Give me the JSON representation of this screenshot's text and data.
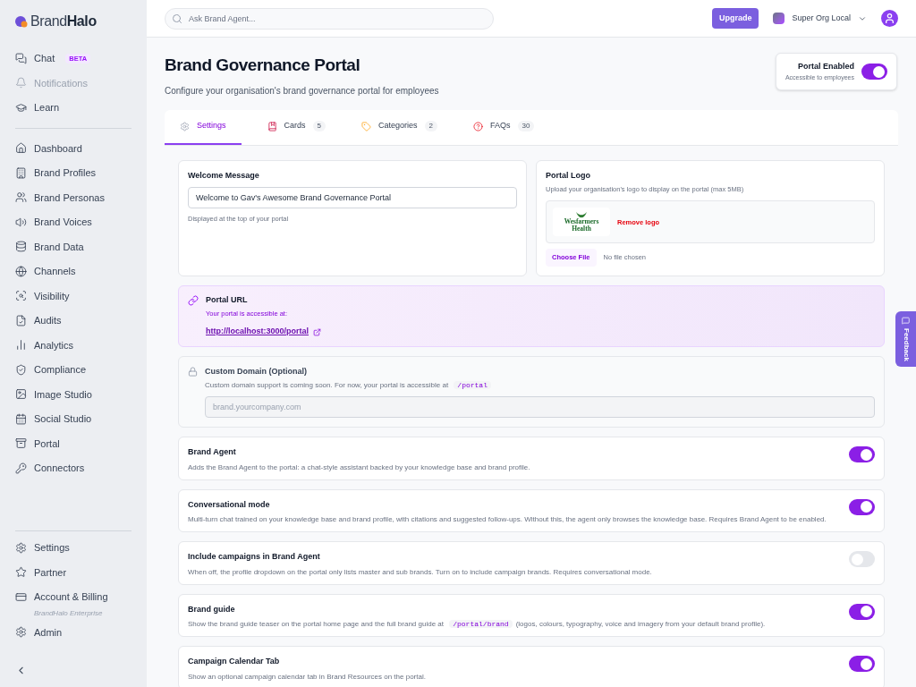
{
  "sidebar": {
    "brand": {
      "light": "Brand",
      "bold": "Halo"
    },
    "top_items": [
      {
        "label": "Chat",
        "badge": "BETA",
        "disabled": false
      },
      {
        "label": "Notifications",
        "disabled": true
      },
      {
        "label": "Learn",
        "disabled": false
      }
    ],
    "items": [
      {
        "label": "Dashboard"
      },
      {
        "label": "Brand Profiles"
      },
      {
        "label": "Brand Personas"
      },
      {
        "label": "Brand Voices"
      },
      {
        "label": "Brand Data"
      },
      {
        "label": "Channels"
      },
      {
        "label": "Visibility"
      },
      {
        "label": "Audits"
      },
      {
        "label": "Analytics"
      },
      {
        "label": "Compliance"
      },
      {
        "label": "Image Studio"
      },
      {
        "label": "Social Studio"
      },
      {
        "label": "Portal"
      },
      {
        "label": "Connectors"
      }
    ],
    "bottom_items": [
      {
        "label": "Settings"
      },
      {
        "label": "Partner"
      },
      {
        "label": "Account & Billing",
        "sub": "BrandHalo Enterprise"
      },
      {
        "label": "Admin"
      }
    ]
  },
  "topbar": {
    "search_placeholder": "Ask Brand Agent...",
    "upgrade": "Upgrade",
    "org": "Super Org Local"
  },
  "page": {
    "title": "Brand Governance Portal",
    "subtitle": "Configure your organisation's brand governance portal for employees",
    "portal_toggle": {
      "label": "Portal Enabled",
      "hint": "Accessible to employees",
      "on": true
    }
  },
  "tabs": [
    {
      "label": "Settings",
      "selected": true
    },
    {
      "label": "Cards",
      "count": "5",
      "selected": false
    },
    {
      "label": "Categories",
      "count": "2",
      "selected": false
    },
    {
      "label": "FAQs",
      "count": "30",
      "selected": false
    }
  ],
  "welcome": {
    "title": "Welcome Message",
    "value": "Welcome to Gav's Awesome Brand Governance Portal",
    "help": "Displayed at the top of your portal"
  },
  "logo": {
    "title": "Portal Logo",
    "help": "Upload your organisation's logo to display on the portal (max 5MB)",
    "logo_text": "Wesfarmers Health",
    "remove": "Remove logo",
    "choose": "Choose File",
    "file_status": "No file chosen"
  },
  "portal_url": {
    "title": "Portal URL",
    "text": "Your portal is accessible at:",
    "url": "http://localhost:3000/portal"
  },
  "custom_domain": {
    "title": "Custom Domain (Optional)",
    "description": [
      {
        "kind": "text",
        "text": "Custom domain support is coming soon. For now, your portal is accessible at"
      },
      {
        "kind": "code",
        "text": "/portal"
      }
    ],
    "placeholder": "brand.yourcompany.com"
  },
  "toggles": [
    {
      "title": "Brand Agent",
      "on": true,
      "description": [
        {
          "kind": "text",
          "text": "Adds the Brand Agent to the portal: a chat-style assistant backed by your knowledge base and brand profile."
        }
      ]
    },
    {
      "title": "Conversational mode",
      "on": true,
      "description": [
        {
          "kind": "text",
          "text": "Multi-turn chat trained on your knowledge base and brand profile, with citations and suggested follow-ups. Without this, the agent only browses the knowledge base. Requires Brand Agent to be enabled."
        }
      ]
    },
    {
      "title": "Include campaigns in Brand Agent",
      "on": false,
      "description": [
        {
          "kind": "text",
          "text": "When off, the profile dropdown on the portal only lists master and sub brands. Turn on to include campaign brands. Requires conversational mode."
        }
      ]
    },
    {
      "title": "Brand guide",
      "on": true,
      "description": [
        {
          "kind": "text",
          "text": "Show the brand guide teaser on the portal home page and the full brand guide at"
        },
        {
          "kind": "code",
          "text": "/portal/brand"
        },
        {
          "kind": "text",
          "text": "(logos, colours, typography, voice and imagery from your default brand profile)."
        }
      ]
    },
    {
      "title": "Campaign Calendar Tab",
      "on": true,
      "description": [
        {
          "kind": "text",
          "text": "Show an optional campaign calendar tab in Brand Resources on the portal."
        }
      ]
    }
  ],
  "feedback": "Feedback"
}
